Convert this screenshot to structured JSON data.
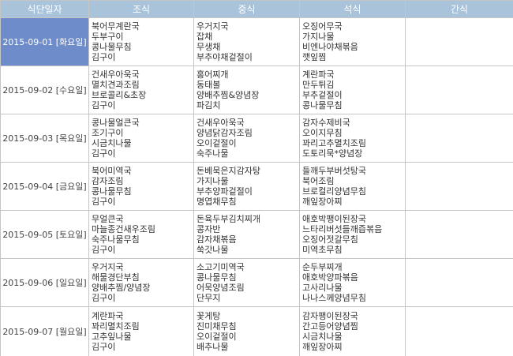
{
  "headers": {
    "date": "식단일자",
    "breakfast": "조식",
    "lunch": "중식",
    "dinner": "석식",
    "snack": "간식"
  },
  "colors": {
    "header_bg": "#a9c3da",
    "selected_bg": "#6d8cc9",
    "grid": "#c5c5c5"
  },
  "rows": [
    {
      "date": "2015-09-01 [화요일]",
      "selected": true,
      "breakfast": [
        "북어무계란국",
        "두부구이",
        "콩나물무침",
        "김구이"
      ],
      "lunch": [
        "우거지국",
        "잡채",
        "무생채",
        "부추야채겉절이"
      ],
      "dinner": [
        "오징어무국",
        "가지나물",
        "비엔나야채볶음",
        "깻잎찜"
      ],
      "snack": []
    },
    {
      "date": "2015-09-02 [수요일]",
      "selected": false,
      "breakfast": [
        "건새우아욱국",
        "멸치견과조림",
        "브로콜리&초장",
        "김구이"
      ],
      "lunch": [
        "홍어찌개",
        "동태볼",
        "양배추찜&양념장",
        "파김치"
      ],
      "dinner": [
        "계란파국",
        "만두튀김",
        "부추겉절이",
        "콩나물무침"
      ],
      "snack": []
    },
    {
      "date": "2015-09-03 [목요일]",
      "selected": false,
      "breakfast": [
        "콩나물얼큰국",
        "조기구이",
        "시금치나물",
        "김구이"
      ],
      "lunch": [
        "건새우아욱국",
        "양념닭감자조림",
        "오이겉절이",
        "숙주나물"
      ],
      "dinner": [
        "감자수제비국",
        "오이지무침",
        "꽈리고추멸치조림",
        "도토리묵*양념장"
      ],
      "snack": []
    },
    {
      "date": "2015-09-04 [금요일]",
      "selected": false,
      "breakfast": [
        "북어미역국",
        "감자조림",
        "콩나물무침",
        "김구이"
      ],
      "lunch": [
        "돈베묵은지감자탕",
        "가지나물",
        "부추양파겉절이",
        "명엽채무침"
      ],
      "dinner": [
        "들깨두부버섯탕국",
        "북어조림",
        "브로컬리양념무침",
        "깨잎장아찌"
      ],
      "snack": []
    },
    {
      "date": "2015-09-05 [토요일]",
      "selected": false,
      "breakfast": [
        "무얼큰국",
        "마늘종건새우조림",
        "숙주나물무침",
        "김구이"
      ],
      "lunch": [
        "돈육두부김치찌개",
        "콩자반",
        "감자채볶음",
        "쑥갓나물"
      ],
      "dinner": [
        "애호박팽이된장국",
        "느타리버섯들깨즙볶음",
        "오징어젓갈무침",
        "미역초무침"
      ],
      "snack": []
    },
    {
      "date": "2015-09-06 [일요일]",
      "selected": false,
      "breakfast": [
        "우거지국",
        "해물경단부침",
        "양배추찜/양념장",
        "김구이"
      ],
      "lunch": [
        "소고기미역국",
        "콩나물무침",
        "어묵양념조림",
        "단무지"
      ],
      "dinner": [
        "순두부찌개",
        "애호박양파볶음",
        "고사리나물",
        "나나스께양념무침"
      ],
      "snack": []
    },
    {
      "date": "2015-09-07 [월요일]",
      "selected": false,
      "breakfast": [
        "계란파국",
        "꽈리멸치조림",
        "고추잎나물",
        "김구이"
      ],
      "lunch": [
        "꽃게탕",
        "진미채무침",
        "오이겉절이",
        "배추나물"
      ],
      "dinner": [
        "감자팽이된장국",
        "간고등어양념찜",
        "시금치나물",
        "깨잎장아찌"
      ],
      "snack": []
    }
  ]
}
